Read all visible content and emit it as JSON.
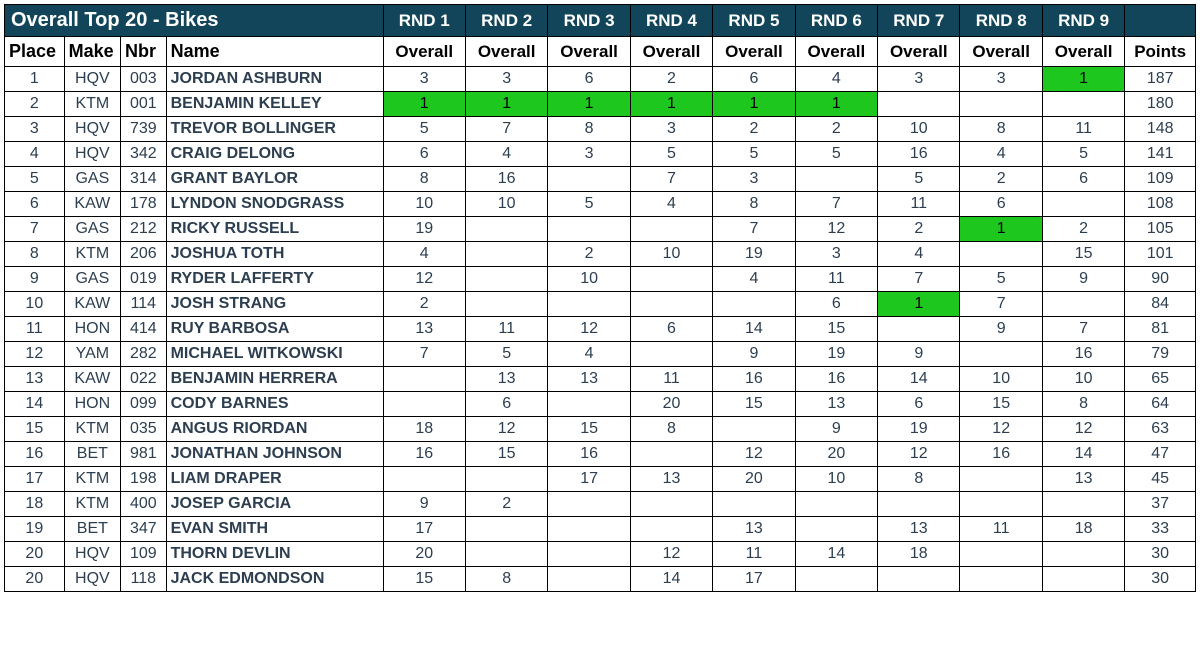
{
  "title": "Overall Top 20 - Bikes",
  "rounds": [
    "RND 1",
    "RND 2",
    "RND 3",
    "RND 4",
    "RND 5",
    "RND 6",
    "RND 7",
    "RND 8",
    "RND 9"
  ],
  "sub": {
    "place": "Place",
    "make": "Make",
    "nbr": "Nbr",
    "name": "Name",
    "overall": "Overall",
    "points": "Points"
  },
  "chart_data": {
    "type": "table",
    "title": "Overall Top 20 - Bikes",
    "columns": [
      "Place",
      "Make",
      "Nbr",
      "Name",
      "RND1",
      "RND2",
      "RND3",
      "RND4",
      "RND5",
      "RND6",
      "RND7",
      "RND8",
      "RND9",
      "Points"
    ]
  },
  "rows": [
    {
      "place": "1",
      "make": "HQV",
      "nbr": "003",
      "name": "JORDAN ASHBURN",
      "r": [
        "3",
        "3",
        "6",
        "2",
        "6",
        "4",
        "3",
        "3",
        "1"
      ],
      "hl": [
        false,
        false,
        false,
        false,
        false,
        false,
        false,
        false,
        true
      ],
      "pts": "187"
    },
    {
      "place": "2",
      "make": "KTM",
      "nbr": "001",
      "name": "BENJAMIN KELLEY",
      "r": [
        "1",
        "1",
        "1",
        "1",
        "1",
        "1",
        "",
        "",
        ""
      ],
      "hl": [
        true,
        true,
        true,
        true,
        true,
        true,
        false,
        false,
        false
      ],
      "pts": "180"
    },
    {
      "place": "3",
      "make": "HQV",
      "nbr": "739",
      "name": "TREVOR BOLLINGER",
      "r": [
        "5",
        "7",
        "8",
        "3",
        "2",
        "2",
        "10",
        "8",
        "11"
      ],
      "hl": [
        false,
        false,
        false,
        false,
        false,
        false,
        false,
        false,
        false
      ],
      "pts": "148"
    },
    {
      "place": "4",
      "make": "HQV",
      "nbr": "342",
      "name": "CRAIG DELONG",
      "r": [
        "6",
        "4",
        "3",
        "5",
        "5",
        "5",
        "16",
        "4",
        "5"
      ],
      "hl": [
        false,
        false,
        false,
        false,
        false,
        false,
        false,
        false,
        false
      ],
      "pts": "141"
    },
    {
      "place": "5",
      "make": "GAS",
      "nbr": "314",
      "name": "GRANT BAYLOR",
      "r": [
        "8",
        "16",
        "",
        "7",
        "3",
        "",
        "5",
        "2",
        "6"
      ],
      "hl": [
        false,
        false,
        false,
        false,
        false,
        false,
        false,
        false,
        false
      ],
      "pts": "109"
    },
    {
      "place": "6",
      "make": "KAW",
      "nbr": "178",
      "name": "LYNDON SNODGRASS",
      "r": [
        "10",
        "10",
        "5",
        "4",
        "8",
        "7",
        "11",
        "6",
        ""
      ],
      "hl": [
        false,
        false,
        false,
        false,
        false,
        false,
        false,
        false,
        false
      ],
      "pts": "108"
    },
    {
      "place": "7",
      "make": "GAS",
      "nbr": "212",
      "name": "RICKY RUSSELL",
      "r": [
        "19",
        "",
        "",
        "",
        "7",
        "12",
        "2",
        "1",
        "2"
      ],
      "hl": [
        false,
        false,
        false,
        false,
        false,
        false,
        false,
        true,
        false
      ],
      "pts": "105"
    },
    {
      "place": "8",
      "make": "KTM",
      "nbr": "206",
      "name": "JOSHUA TOTH",
      "r": [
        "4",
        "",
        "2",
        "10",
        "19",
        "3",
        "4",
        "",
        "15"
      ],
      "hl": [
        false,
        false,
        false,
        false,
        false,
        false,
        false,
        false,
        false
      ],
      "pts": "101"
    },
    {
      "place": "9",
      "make": "GAS",
      "nbr": "019",
      "name": "RYDER LAFFERTY",
      "r": [
        "12",
        "",
        "10",
        "",
        "4",
        "11",
        "7",
        "5",
        "9"
      ],
      "hl": [
        false,
        false,
        false,
        false,
        false,
        false,
        false,
        false,
        false
      ],
      "pts": "90"
    },
    {
      "place": "10",
      "make": "KAW",
      "nbr": "114",
      "name": "JOSH STRANG",
      "r": [
        "2",
        "",
        "",
        "",
        "",
        "6",
        "1",
        "7",
        ""
      ],
      "hl": [
        false,
        false,
        false,
        false,
        false,
        false,
        true,
        false,
        false
      ],
      "pts": "84"
    },
    {
      "place": "11",
      "make": "HON",
      "nbr": "414",
      "name": "RUY BARBOSA",
      "r": [
        "13",
        "11",
        "12",
        "6",
        "14",
        "15",
        "",
        "9",
        "7"
      ],
      "hl": [
        false,
        false,
        false,
        false,
        false,
        false,
        false,
        false,
        false
      ],
      "pts": "81"
    },
    {
      "place": "12",
      "make": "YAM",
      "nbr": "282",
      "name": "MICHAEL WITKOWSKI",
      "r": [
        "7",
        "5",
        "4",
        "",
        "9",
        "19",
        "9",
        "",
        "16"
      ],
      "hl": [
        false,
        false,
        false,
        false,
        false,
        false,
        false,
        false,
        false
      ],
      "pts": "79"
    },
    {
      "place": "13",
      "make": "KAW",
      "nbr": "022",
      "name": "BENJAMIN HERRERA",
      "r": [
        "",
        "13",
        "13",
        "11",
        "16",
        "16",
        "14",
        "10",
        "10"
      ],
      "hl": [
        false,
        false,
        false,
        false,
        false,
        false,
        false,
        false,
        false
      ],
      "pts": "65"
    },
    {
      "place": "14",
      "make": "HON",
      "nbr": "099",
      "name": "CODY BARNES",
      "r": [
        "",
        "6",
        "",
        "20",
        "15",
        "13",
        "6",
        "15",
        "8"
      ],
      "hl": [
        false,
        false,
        false,
        false,
        false,
        false,
        false,
        false,
        false
      ],
      "pts": "64"
    },
    {
      "place": "15",
      "make": "KTM",
      "nbr": "035",
      "name": "ANGUS RIORDAN",
      "r": [
        "18",
        "12",
        "15",
        "8",
        "",
        "9",
        "19",
        "12",
        "12"
      ],
      "hl": [
        false,
        false,
        false,
        false,
        false,
        false,
        false,
        false,
        false
      ],
      "pts": "63"
    },
    {
      "place": "16",
      "make": "BET",
      "nbr": "981",
      "name": "JONATHAN JOHNSON",
      "r": [
        "16",
        "15",
        "16",
        "",
        "12",
        "20",
        "12",
        "16",
        "14"
      ],
      "hl": [
        false,
        false,
        false,
        false,
        false,
        false,
        false,
        false,
        false
      ],
      "pts": "47"
    },
    {
      "place": "17",
      "make": "KTM",
      "nbr": "198",
      "name": "LIAM DRAPER",
      "r": [
        "",
        "",
        "17",
        "13",
        "20",
        "10",
        "8",
        "",
        "13"
      ],
      "hl": [
        false,
        false,
        false,
        false,
        false,
        false,
        false,
        false,
        false
      ],
      "pts": "45"
    },
    {
      "place": "18",
      "make": "KTM",
      "nbr": "400",
      "name": "JOSEP GARCIA",
      "r": [
        "9",
        "2",
        "",
        "",
        "",
        "",
        "",
        "",
        ""
      ],
      "hl": [
        false,
        false,
        false,
        false,
        false,
        false,
        false,
        false,
        false
      ],
      "pts": "37"
    },
    {
      "place": "19",
      "make": "BET",
      "nbr": "347",
      "name": "EVAN SMITH",
      "r": [
        "17",
        "",
        "",
        "",
        "13",
        "",
        "13",
        "11",
        "18"
      ],
      "hl": [
        false,
        false,
        false,
        false,
        false,
        false,
        false,
        false,
        false
      ],
      "pts": "33"
    },
    {
      "place": "20",
      "make": "HQV",
      "nbr": "109",
      "name": "THORN DEVLIN",
      "r": [
        "20",
        "",
        "",
        "12",
        "11",
        "14",
        "18",
        "",
        ""
      ],
      "hl": [
        false,
        false,
        false,
        false,
        false,
        false,
        false,
        false,
        false
      ],
      "pts": "30"
    },
    {
      "place": "20",
      "make": "HQV",
      "nbr": "118",
      "name": "JACK EDMONDSON",
      "r": [
        "15",
        "8",
        "",
        "14",
        "17",
        "",
        "",
        "",
        ""
      ],
      "hl": [
        false,
        false,
        false,
        false,
        false,
        false,
        false,
        false,
        false
      ],
      "pts": "30"
    }
  ]
}
